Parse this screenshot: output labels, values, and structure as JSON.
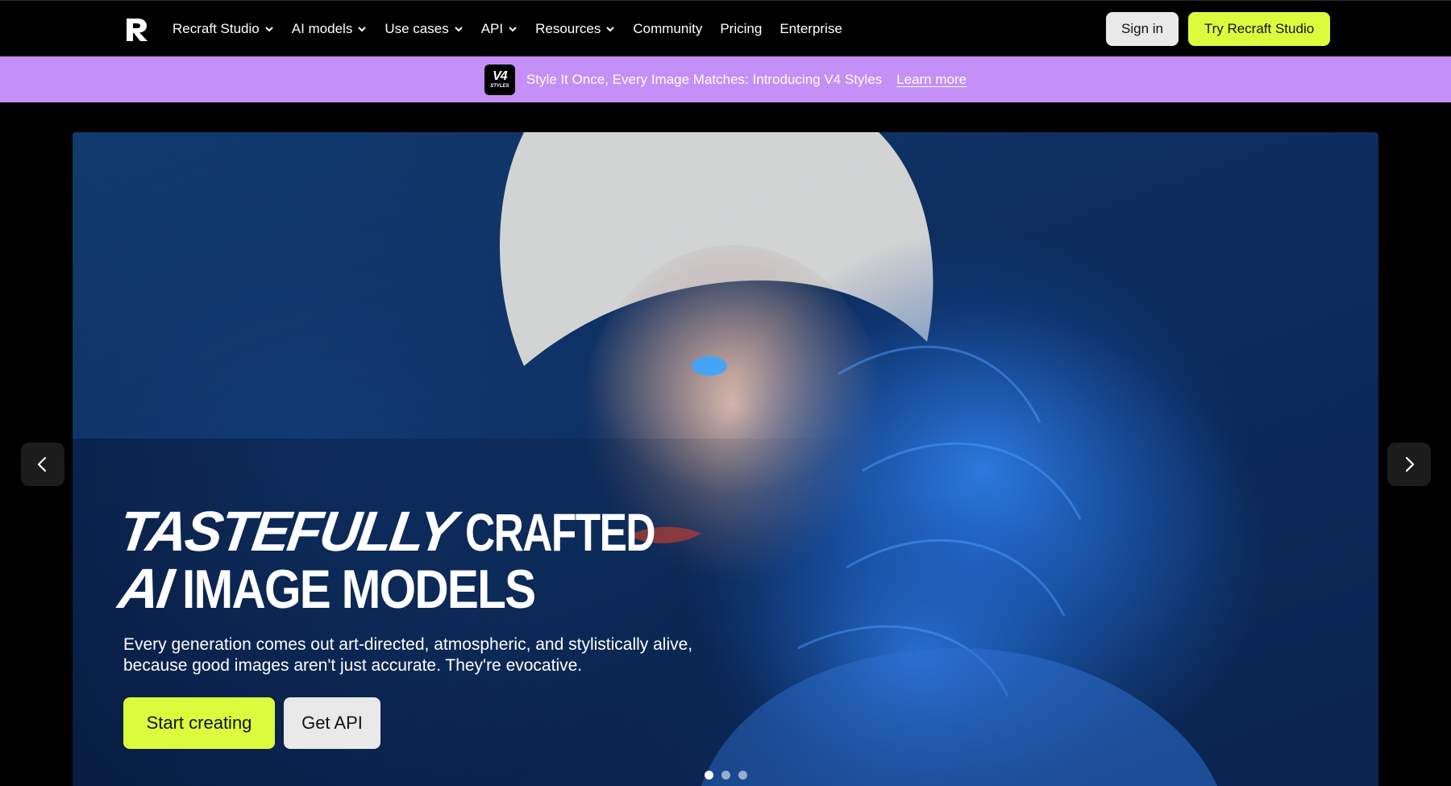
{
  "nav": {
    "logo_icon": "recraft-logo-icon",
    "items": [
      {
        "label": "Recraft Studio",
        "has_dropdown": true
      },
      {
        "label": "AI models",
        "has_dropdown": true
      },
      {
        "label": "Use cases",
        "has_dropdown": true
      },
      {
        "label": "API",
        "has_dropdown": true
      },
      {
        "label": "Resources",
        "has_dropdown": true
      },
      {
        "label": "Community",
        "has_dropdown": false
      },
      {
        "label": "Pricing",
        "has_dropdown": false
      },
      {
        "label": "Enterprise",
        "has_dropdown": false
      }
    ],
    "sign_in_label": "Sign in",
    "try_label": "Try Recraft Studio"
  },
  "banner": {
    "badge_main": "V4",
    "badge_sub": "STYLES",
    "text": "Style It Once, Every Image Matches: Introducing V4 Styles",
    "link": "Learn more",
    "color": "#c48ff6"
  },
  "hero": {
    "headline_line1_italic": "TASTEFULLY",
    "headline_line1_rest": "CRAFTED",
    "headline_line2_italic": "AI",
    "headline_line2_rest": "IMAGE MODELS",
    "subtitle": "Every generation comes out art-directed, atmospheric, and stylistically alive, because good images aren't just accurate. They're evocative.",
    "primary_cta": "Start creating",
    "secondary_cta": "Get API",
    "slides_total": 3,
    "active_slide": 1,
    "prev_icon": "chevron-left-icon",
    "next_icon": "chevron-right-icon"
  },
  "colors": {
    "accent": "#dcfb3c",
    "background": "#000000",
    "secondary_button": "#e9e9e9"
  }
}
